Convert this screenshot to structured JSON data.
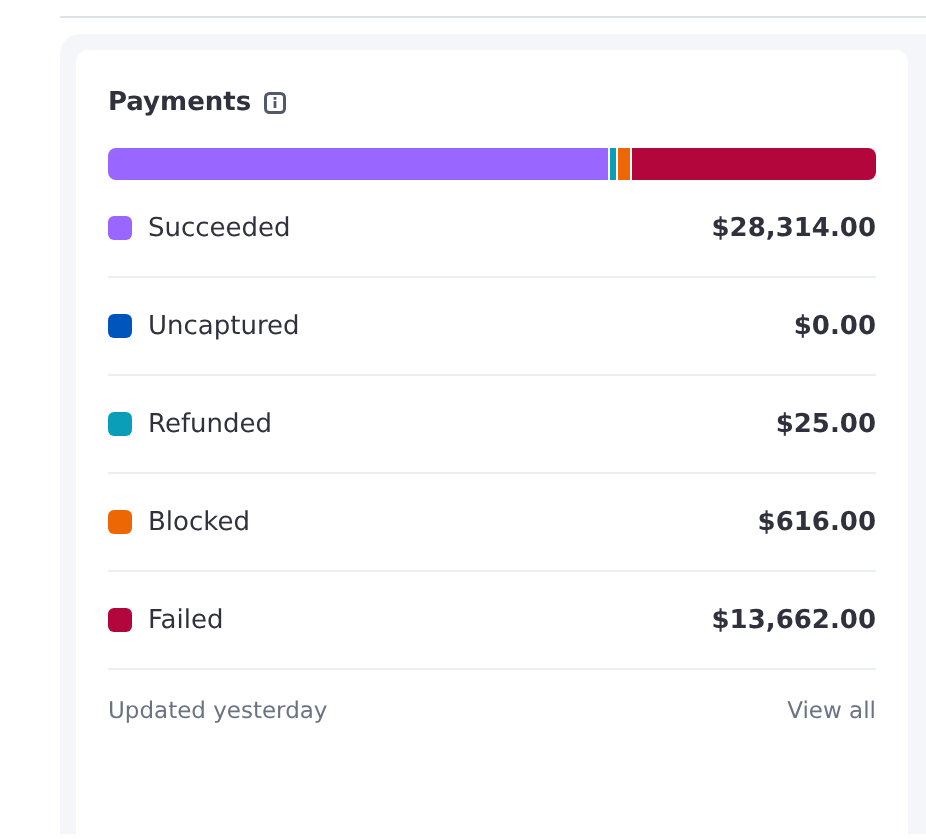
{
  "card": {
    "title": "Payments",
    "categories": [
      {
        "label": "Succeeded",
        "amount": "$28,314.00",
        "color": "#9966ff",
        "level": 0.652
      },
      {
        "label": "Uncaptured",
        "amount": "$0.00",
        "color": "#0055bc",
        "level": 0
      },
      {
        "label": "Refunded",
        "amount": "$25.00",
        "color": "#0a9eb8",
        "level": 0.01
      },
      {
        "label": "Blocked",
        "amount": "$616.00",
        "color": "#ed6704",
        "level": 0.018
      },
      {
        "label": "Failed",
        "amount": "$13,662.00",
        "color": "#b3063d",
        "level": 0.32
      }
    ],
    "footer": {
      "updated": "Updated yesterday",
      "link": "View all"
    }
  }
}
